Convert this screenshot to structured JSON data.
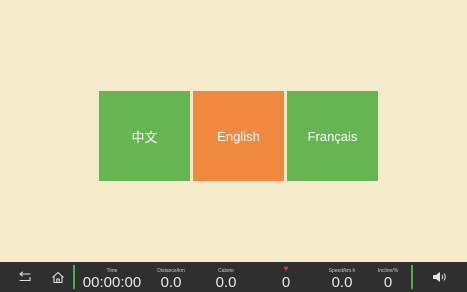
{
  "languages": [
    {
      "label": "中文",
      "color": "#67b552"
    },
    {
      "label": "English",
      "color": "#f0883f"
    },
    {
      "label": "Français",
      "color": "#67b552"
    }
  ],
  "status_bar": {
    "metrics": [
      {
        "label": "Time",
        "value": "00:00:00"
      },
      {
        "label": "Distance/km",
        "value": "0.0"
      },
      {
        "label": "Calorie",
        "value": "0.0"
      },
      {
        "label": "",
        "value": "0",
        "icon": "heart-icon"
      },
      {
        "label": "Speed/km.h",
        "value": "0.0"
      },
      {
        "label": "Incline/%",
        "value": "0"
      }
    ],
    "icons": [
      "back-icon",
      "home-icon",
      "heart-icon",
      "volume-icon"
    ]
  },
  "colors": {
    "background": "#f5ebcb",
    "bar": "#2f2f2f",
    "green": "#67b552",
    "orange": "#f0883f",
    "separator": "#47b04b",
    "heart": "#e43d3d"
  }
}
